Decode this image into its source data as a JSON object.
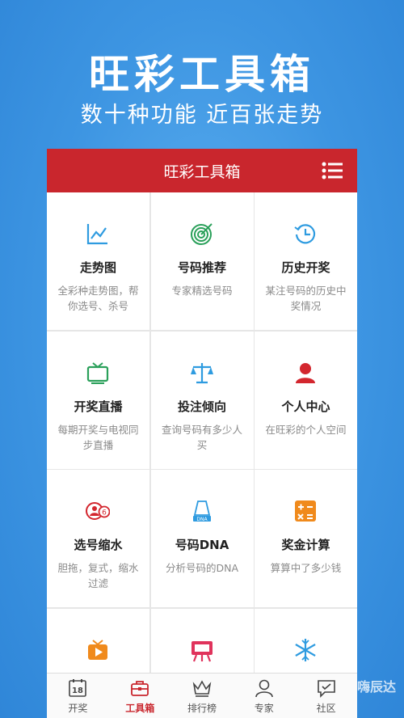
{
  "hero": {
    "title": "旺彩工具箱",
    "subtitle": "数十种功能 近百张走势"
  },
  "header": {
    "title": "旺彩工具箱"
  },
  "tools": [
    {
      "name": "走势图",
      "desc": "全彩种走势图，帮你选号、杀号",
      "icon": "trend-chart-icon"
    },
    {
      "name": "号码推荐",
      "desc": "专家精选号码",
      "icon": "target-icon"
    },
    {
      "name": "历史开奖",
      "desc": "某注号码的历史中奖情况",
      "icon": "history-clock-icon"
    },
    {
      "name": "开奖直播",
      "desc": "每期开奖与电视同步直播",
      "icon": "tv-icon"
    },
    {
      "name": "投注倾向",
      "desc": "查询号码有多少人买",
      "icon": "scale-icon"
    },
    {
      "name": "个人中心",
      "desc": "在旺彩的个人空间",
      "icon": "user-icon"
    },
    {
      "name": "选号缩水",
      "desc": "胆拖，复式，缩水过滤",
      "icon": "number-filter-icon"
    },
    {
      "name": "号码DNA",
      "desc": "分析号码的DNA",
      "icon": "dna-icon"
    },
    {
      "name": "奖金计算",
      "desc": "算算中了多少钱",
      "icon": "calculator-icon"
    },
    {
      "name": "",
      "desc": "",
      "icon": "play-tv-icon"
    },
    {
      "name": "",
      "desc": "",
      "icon": "easel-icon"
    },
    {
      "name": "",
      "desc": "",
      "icon": "snowflake-icon"
    }
  ],
  "tabs": [
    {
      "label": "开奖",
      "icon": "calendar-18-icon",
      "calendar_text": "18"
    },
    {
      "label": "工具箱",
      "icon": "toolbox-icon",
      "active": true
    },
    {
      "label": "排行榜",
      "icon": "crown-icon"
    },
    {
      "label": "专家",
      "icon": "expert-user-icon"
    },
    {
      "label": "社区",
      "icon": "chat-icon"
    }
  ],
  "watermark": "嗨辰达",
  "colors": {
    "brand_red": "#c9262d",
    "background_blue": "#3d95e2",
    "icon_blue": "#2e9be0",
    "icon_green": "#2aa05a",
    "icon_orange": "#f08a1c",
    "icon_pink": "#e0335c"
  }
}
